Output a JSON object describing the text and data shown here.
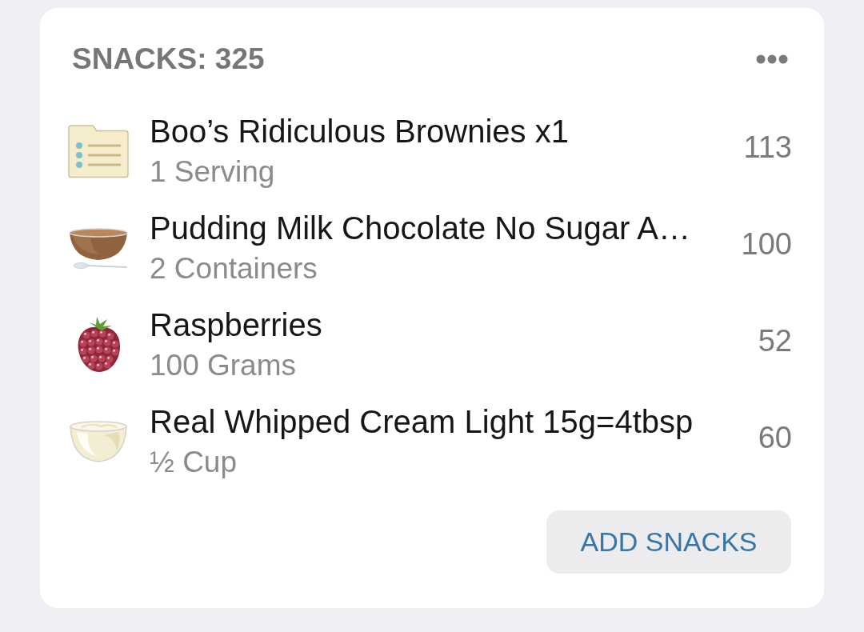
{
  "meal_card": {
    "heading": "SNACKS: 325",
    "entries": [
      {
        "name": "Boo’s Ridiculous Brownies x1",
        "serving": "1 Serving",
        "calories": "113"
      },
      {
        "name": "Pudding Milk Chocolate No Sugar A…",
        "serving": "2 Containers",
        "calories": "100"
      },
      {
        "name": "Raspberries",
        "serving": "100 Grams",
        "calories": "52"
      },
      {
        "name": "Real Whipped Cream Light 15g=4tbsp",
        "serving": "½ Cup",
        "calories": "60"
      }
    ],
    "add_button": "ADD SNACKS"
  }
}
